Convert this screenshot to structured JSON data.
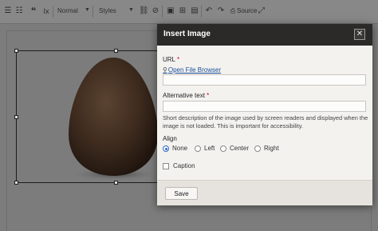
{
  "toolbar": {
    "format_combo": "Normal",
    "styles_combo": "Styles",
    "source_label": "Source",
    "icons": [
      "bulleted-list",
      "numbered-list",
      "blockquote",
      "remove-format",
      "link",
      "unlink",
      "image",
      "table",
      "horizontal-rule",
      "undo",
      "redo",
      "source"
    ]
  },
  "dialog": {
    "title": "Insert Image",
    "close_symbol": "✕",
    "url_label": "URL",
    "required_mark": "*",
    "file_browser_link": "Open File Browser",
    "url_value": "",
    "alt_label": "Alternative text",
    "alt_value": "",
    "alt_description": "Short description of the image used by screen readers and displayed when the image is not loaded. This is important for accessibility.",
    "align_label": "Align",
    "align_options": [
      "None",
      "Left",
      "Center",
      "Right"
    ],
    "align_selected": "None",
    "caption_label": "Caption",
    "caption_checked": false,
    "save_label": "Save"
  },
  "colors": {
    "header_bg": "#2b2a29",
    "link": "#1a4f9b",
    "required": "#d0021b",
    "overlay": "#7b7b7b"
  }
}
